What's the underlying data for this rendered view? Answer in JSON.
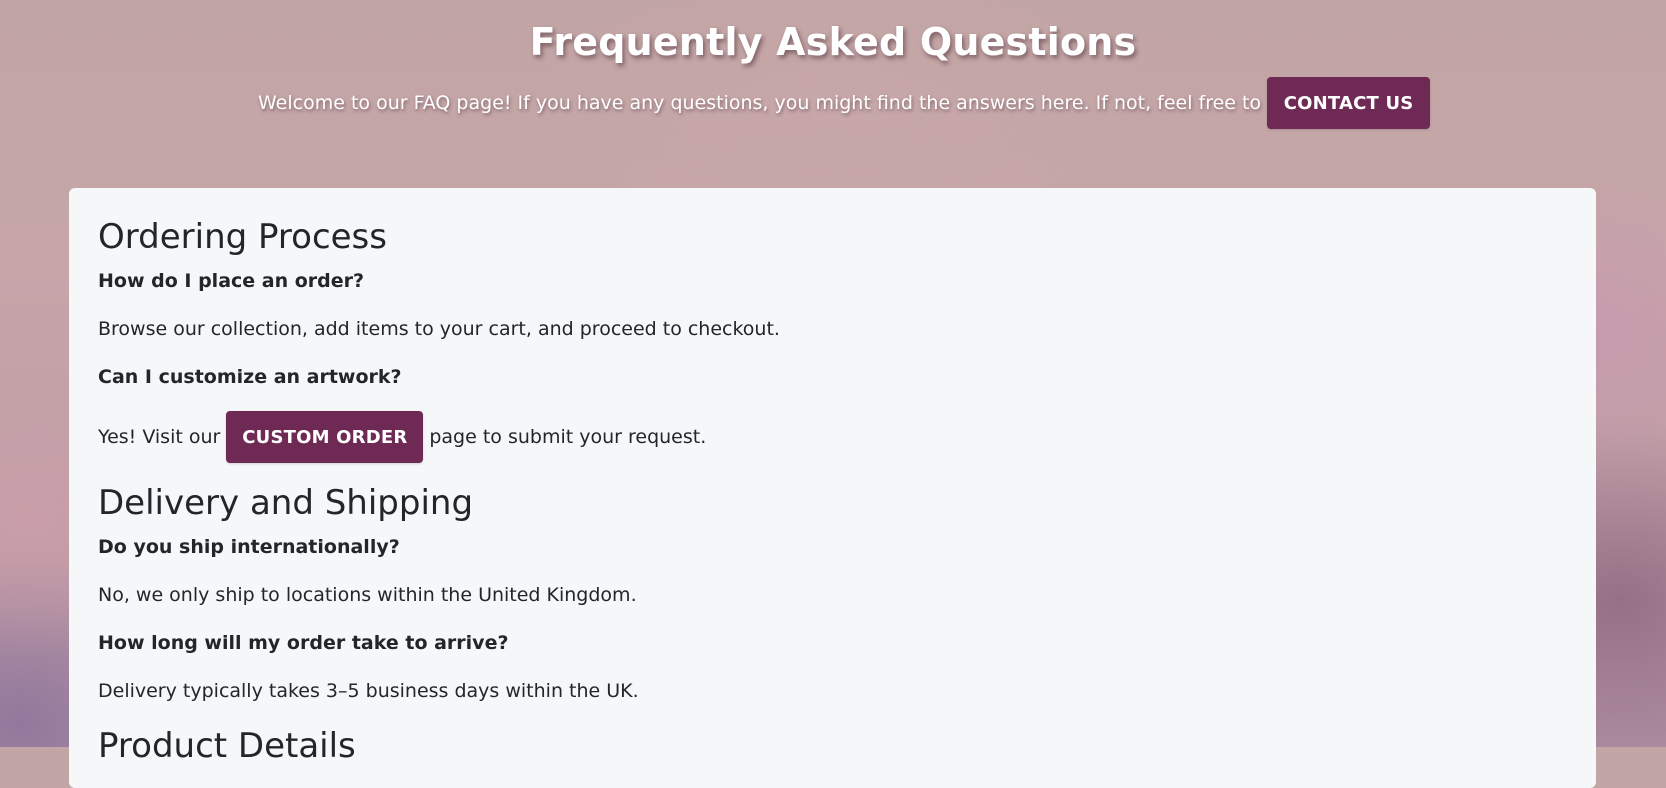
{
  "header": {
    "title": "Frequently Asked Questions",
    "intro": "Welcome to our FAQ page! If you have any questions, you might find the answers here. If not, feel free to",
    "contact_button": "CONTACT US"
  },
  "sections": [
    {
      "title": "Ordering Process",
      "items": [
        {
          "question": "How do I place an order?",
          "answer": "Browse our collection, add items to your cart, and proceed to checkout."
        },
        {
          "question": "Can I customize an artwork?",
          "answer_before": "Yes! Visit our",
          "answer_button": "CUSTOM ORDER",
          "answer_after": "page to submit your request."
        }
      ]
    },
    {
      "title": "Delivery and Shipping",
      "items": [
        {
          "question": "Do you ship internationally?",
          "answer": "No, we only ship to locations within the United Kingdom."
        },
        {
          "question": "How long will my order take to arrive?",
          "answer": "Delivery typically takes 3–5 business days within the UK."
        }
      ]
    },
    {
      "title": "Product Details"
    }
  ]
}
